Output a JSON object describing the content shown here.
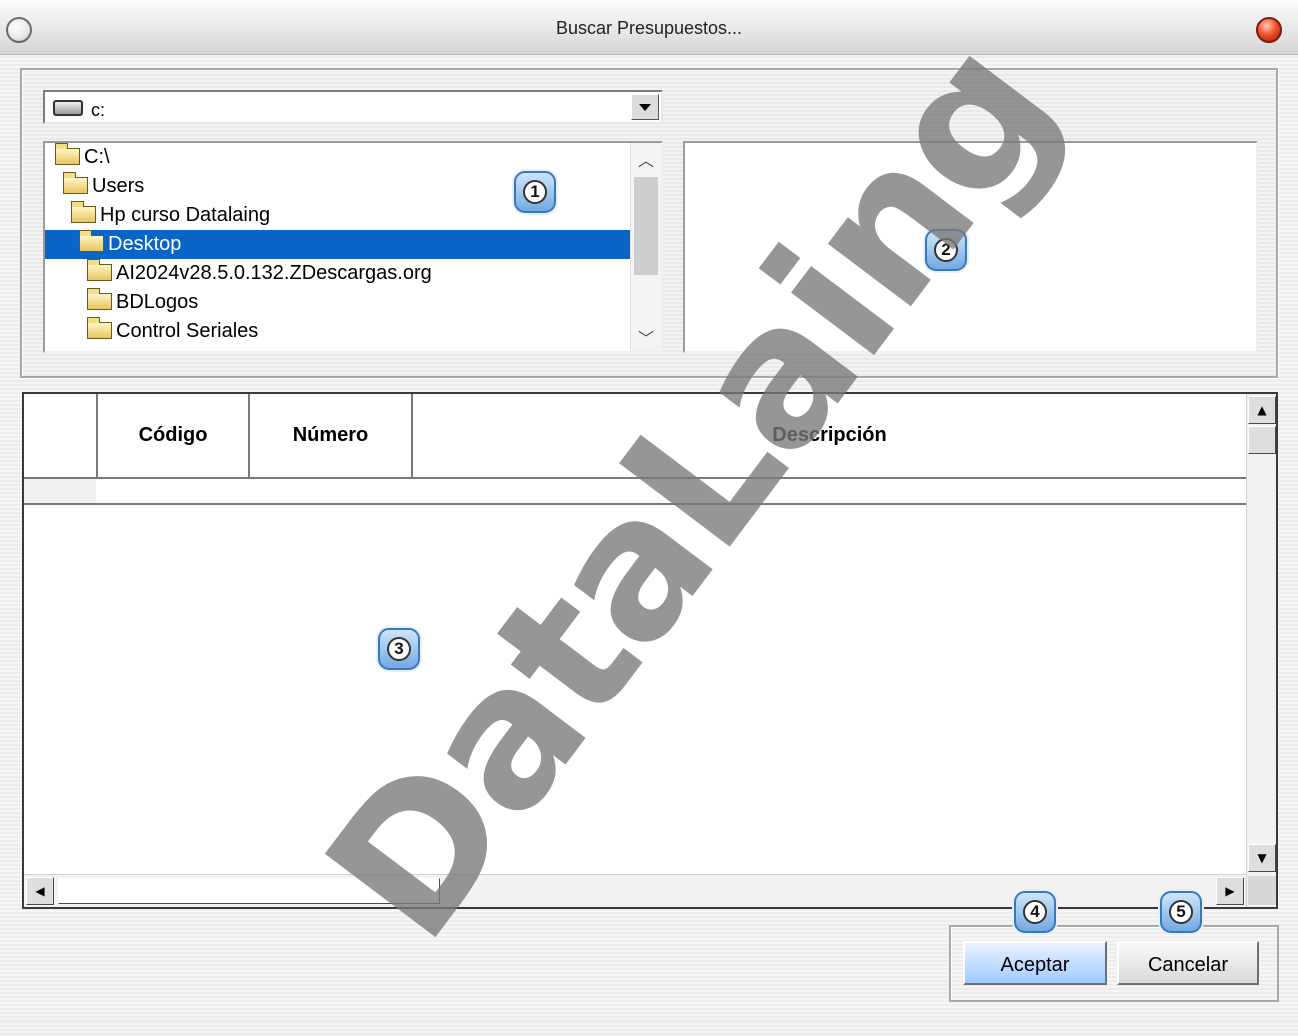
{
  "window": {
    "title": "Buscar Presupuestos..."
  },
  "drive": {
    "label": "c:"
  },
  "directories": [
    {
      "label": "C:\\",
      "indent": 0
    },
    {
      "label": "Users",
      "indent": 1
    },
    {
      "label": "Hp curso Datalaing",
      "indent": 2
    },
    {
      "label": "Desktop",
      "indent": 3,
      "selected": true
    },
    {
      "label": "AI2024v28.5.0.132.ZDescargas.org",
      "indent": 4
    },
    {
      "label": "BDLogos",
      "indent": 4
    },
    {
      "label": "Control Seriales",
      "indent": 4
    }
  ],
  "grid": {
    "columns": [
      "Código",
      "Número",
      "Descripción"
    ]
  },
  "buttons": {
    "accept": "Aceptar",
    "cancel": "Cancelar"
  },
  "callouts": {
    "c1": "1",
    "c2": "2",
    "c3": "3",
    "c4": "4",
    "c5": "5"
  },
  "watermark": "DataLaing",
  "colors": {
    "selection": "#0a64c8",
    "accept_button": "#9ecbff",
    "close_button": "#f0552d"
  }
}
